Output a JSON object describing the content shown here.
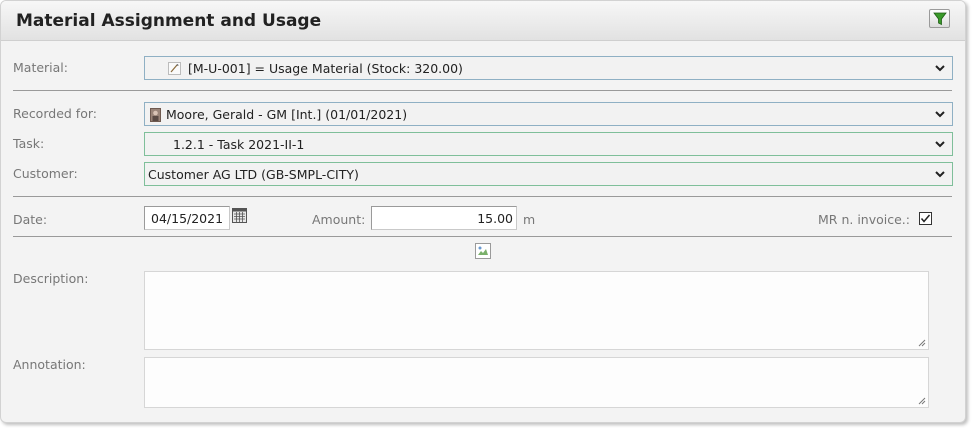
{
  "panel": {
    "title": "Material Assignment and Usage"
  },
  "material": {
    "label": "Material:",
    "value": "[M-U-001] = Usage Material   (Stock: 320.00)",
    "icon": "material-icon"
  },
  "recorded_for": {
    "label": "Recorded for:",
    "value": "Moore, Gerald - GM [Int.] (01/01/2021)",
    "icon": "person-icon"
  },
  "task": {
    "label": "Task:",
    "value": "1.2.1 - Task 2021-II-1"
  },
  "customer": {
    "label": "Customer:",
    "value": "Customer AG LTD (GB-SMPL-CITY)"
  },
  "date": {
    "label": "Date:",
    "value": "04/15/2021",
    "icon": "calendar-icon"
  },
  "amount": {
    "label": "Amount:",
    "value": "15.00",
    "unit": "m"
  },
  "invoice": {
    "label": "MR n. invoice.:",
    "checked": true
  },
  "description": {
    "label": "Description:",
    "value": ""
  },
  "annotation": {
    "label": "Annotation:",
    "value": ""
  },
  "colors": {
    "field_border": "#8fb0c4",
    "accent_green": "#2e8b2e"
  }
}
